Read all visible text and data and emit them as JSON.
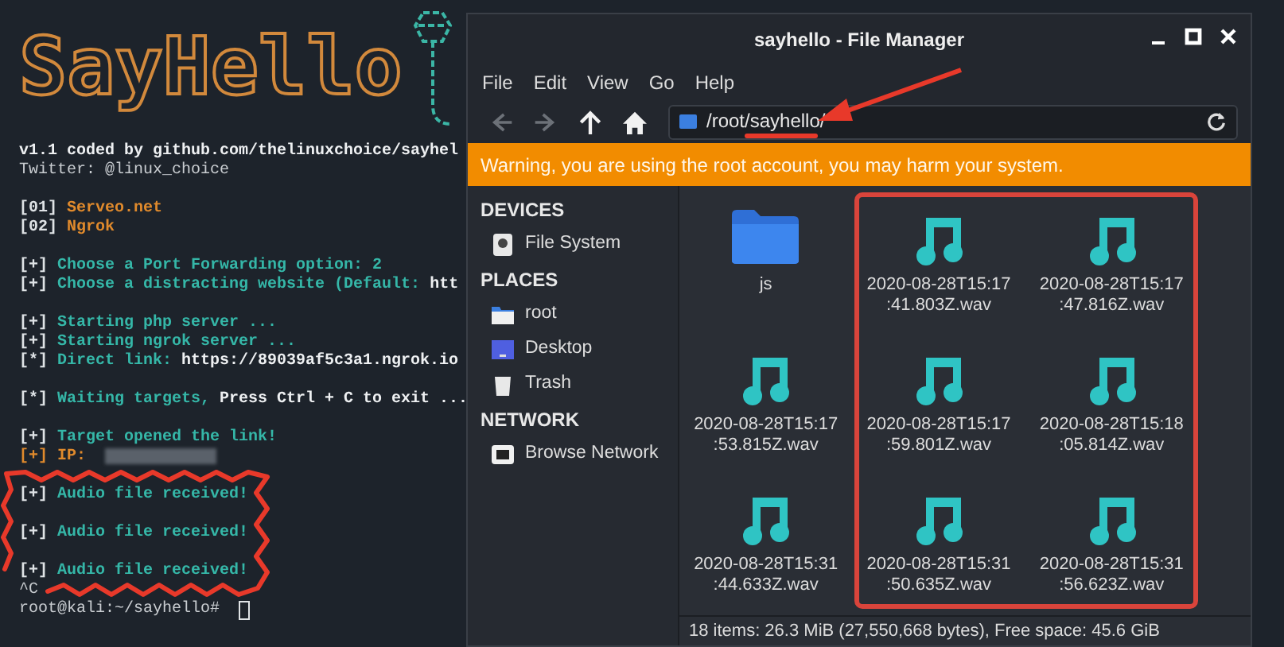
{
  "terminal": {
    "logo": "SayHello",
    "blocks": [
      [
        {
          "segments": [
            {
              "kind": "value",
              "text": "v1.1 coded by github.com/thelinuxchoice/sayhel"
            }
          ]
        },
        {
          "segments": [
            {
              "kind": "plain",
              "text": "Twitter: @linux_choice"
            }
          ]
        }
      ],
      [
        {
          "segments": [
            {
              "kind": "bracket",
              "text": "[01]"
            },
            {
              "kind": "accent",
              "text": "Serveo.net"
            }
          ]
        },
        {
          "segments": [
            {
              "kind": "bracket",
              "text": "[02]"
            },
            {
              "kind": "accent",
              "text": "Ngrok"
            }
          ]
        }
      ],
      [
        {
          "segments": [
            {
              "kind": "bracket",
              "text": "[+]"
            },
            {
              "kind": "label",
              "text": "Choose a Port Forwarding option: 2"
            }
          ]
        },
        {
          "segments": [
            {
              "kind": "bracket",
              "text": "[+]"
            },
            {
              "kind": "label",
              "text": "Choose a distracting website (Default:"
            },
            {
              "kind": "value",
              "text": "htt"
            }
          ]
        }
      ],
      [
        {
          "segments": [
            {
              "kind": "bracket",
              "text": "[+]"
            },
            {
              "kind": "label",
              "text": "Starting php server ..."
            }
          ]
        },
        {
          "segments": [
            {
              "kind": "bracket",
              "text": "[+]"
            },
            {
              "kind": "label",
              "text": "Starting ngrok server ..."
            }
          ]
        },
        {
          "segments": [
            {
              "kind": "bracket",
              "text": "[*]"
            },
            {
              "kind": "label",
              "text": "Direct link:"
            },
            {
              "kind": "value",
              "text": "https://89039af5c3a1.ngrok.io"
            }
          ]
        }
      ],
      [
        {
          "segments": [
            {
              "kind": "bracket",
              "text": "[*]"
            },
            {
              "kind": "label",
              "text": "Waiting targets,"
            },
            {
              "kind": "value",
              "text": "Press Ctrl + C to exit ..."
            }
          ]
        }
      ],
      [
        {
          "segments": [
            {
              "kind": "bracket",
              "text": "[+]"
            },
            {
              "kind": "label",
              "text": "Target opened the link!"
            }
          ]
        },
        {
          "segments": [
            {
              "kind": "accent",
              "text": "[+] IP:"
            },
            {
              "kind": "redacted"
            }
          ]
        }
      ],
      [
        {
          "segments": [
            {
              "kind": "bracket",
              "text": "[+]"
            },
            {
              "kind": "label",
              "text": "Audio file received!"
            }
          ]
        }
      ],
      [
        {
          "segments": [
            {
              "kind": "bracket",
              "text": "[+]"
            },
            {
              "kind": "label",
              "text": "Audio file received!"
            }
          ]
        }
      ],
      [
        {
          "segments": [
            {
              "kind": "bracket",
              "text": "[+]"
            },
            {
              "kind": "label",
              "text": "Audio file received!"
            }
          ]
        },
        {
          "segments": [
            {
              "kind": "plain",
              "text": "^C"
            }
          ]
        },
        {
          "segments": [
            {
              "kind": "plain",
              "text": "root@kali:~/sayhello#"
            },
            {
              "kind": "cursor"
            }
          ]
        }
      ]
    ]
  },
  "file_manager": {
    "title": "sayhello - File Manager",
    "menu": [
      "File",
      "Edit",
      "View",
      "Go",
      "Help"
    ],
    "toolbar": [
      {
        "kind": "back",
        "disabled": true
      },
      {
        "kind": "forward",
        "disabled": true
      },
      {
        "kind": "up",
        "disabled": false
      },
      {
        "kind": "home",
        "disabled": false
      }
    ],
    "path": "/root/sayhello/",
    "warning": "Warning, you are using the root account, you may harm your system.",
    "sidebar": [
      {
        "heading": "DEVICES",
        "items": [
          {
            "kind": "drive",
            "label": "File System"
          }
        ]
      },
      {
        "heading": "PLACES",
        "items": [
          {
            "kind": "folder",
            "label": "root"
          },
          {
            "kind": "desktop",
            "label": "Desktop"
          },
          {
            "kind": "trash",
            "label": "Trash"
          }
        ]
      },
      {
        "heading": "NETWORK",
        "items": [
          {
            "kind": "network",
            "label": "Browse Network"
          }
        ]
      }
    ],
    "files": [
      {
        "kind": "folder",
        "name": "js"
      },
      {
        "kind": "audio",
        "name": "2020-08-28T15:17\n:41.803Z.wav"
      },
      {
        "kind": "audio",
        "name": "2020-08-28T15:17\n:47.816Z.wav"
      },
      {
        "kind": "audio",
        "name": "2020-08-28T15:17\n:53.815Z.wav"
      },
      {
        "kind": "audio",
        "name": "2020-08-28T15:17\n:59.801Z.wav"
      },
      {
        "kind": "audio",
        "name": "2020-08-28T15:18\n:05.814Z.wav"
      },
      {
        "kind": "audio",
        "name": "2020-08-28T15:31\n:44.633Z.wav"
      },
      {
        "kind": "audio",
        "name": "2020-08-28T15:31\n:50.635Z.wav"
      },
      {
        "kind": "audio",
        "name": "2020-08-28T15:31\n:56.623Z.wav"
      }
    ],
    "status": "18 items: 26.3 MiB (27,550,668 bytes), Free space: 45.6 GiB"
  }
}
